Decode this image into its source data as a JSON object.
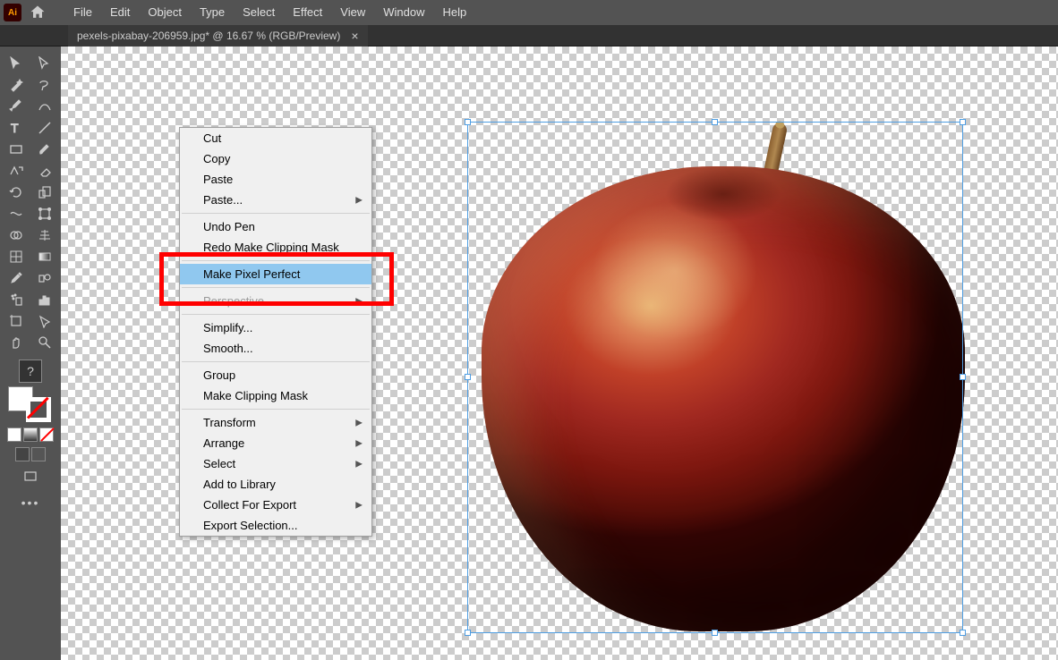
{
  "app": {
    "name": "Ai"
  },
  "menubar": [
    "File",
    "Edit",
    "Object",
    "Type",
    "Select",
    "Effect",
    "View",
    "Window",
    "Help"
  ],
  "tab": {
    "title": "pexels-pixabay-206959.jpg* @ 16.67 % (RGB/Preview)",
    "close": "×"
  },
  "question": "?",
  "context": {
    "cut": "Cut",
    "copy": "Copy",
    "paste": "Paste",
    "paste_sub": "Paste...",
    "undo": "Undo Pen",
    "redo": "Redo Make Clipping Mask",
    "pixel_perfect": "Make Pixel Perfect",
    "perspective": "Perspective",
    "simplify": "Simplify...",
    "smooth": "Smooth...",
    "group": "Group",
    "clip": "Make Clipping Mask",
    "transform": "Transform",
    "arrange": "Arrange",
    "select": "Select",
    "library": "Add to Library",
    "export_collect": "Collect For Export",
    "export_sel": "Export Selection..."
  }
}
